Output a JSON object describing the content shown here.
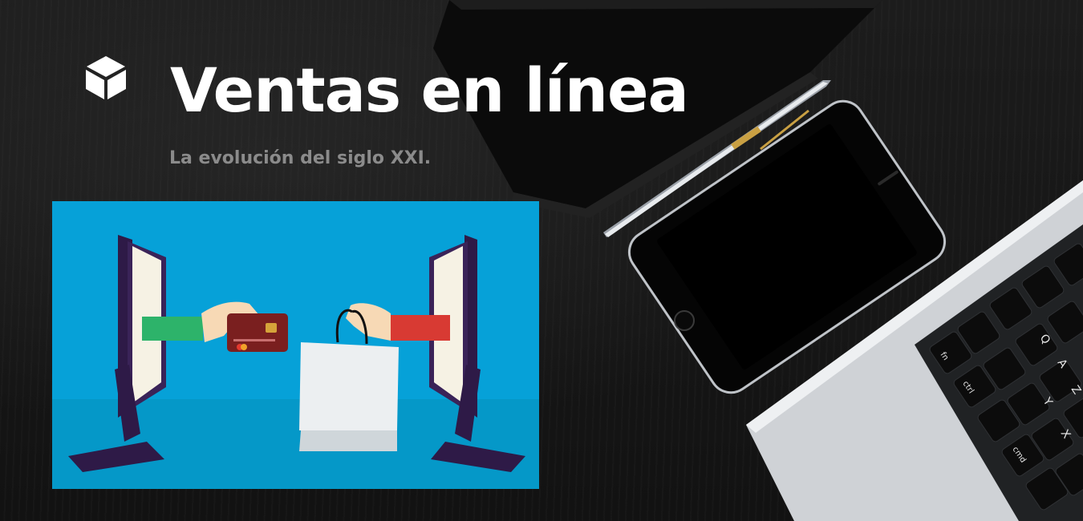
{
  "banner": {
    "title": "Ventas en línea",
    "subtitle": "La evolución del siglo XXI.",
    "logo_icon": "cube-icon",
    "illustration": {
      "description_icon": "online-shopping-illustration",
      "background_color": "#06a1d8"
    },
    "photo_icons": [
      "notebook-icon",
      "pen-icon",
      "smartphone-icon",
      "laptop-keyboard-icon"
    ],
    "keyboard_keys": {
      "fn": "fn",
      "ctrl": "ctrl",
      "cmd": "cmd",
      "a": "A",
      "z": "Z",
      "x": "X",
      "q": "Q",
      "y": "Y"
    }
  }
}
